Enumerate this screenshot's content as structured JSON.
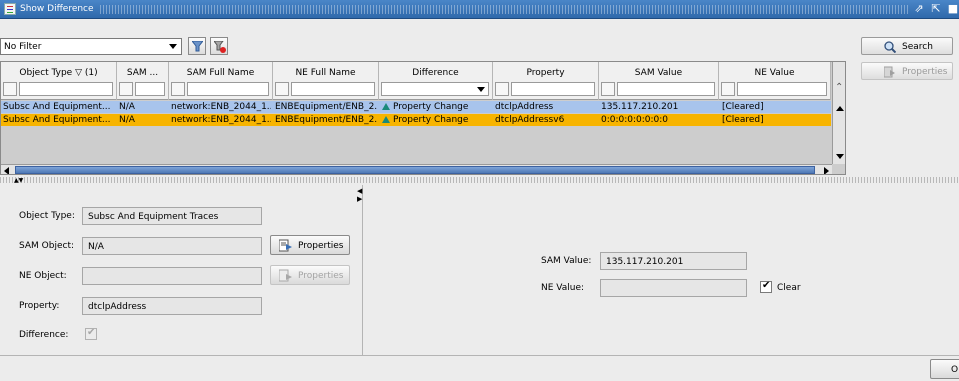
{
  "window": {
    "title": "Show Difference"
  },
  "filter": {
    "selected": "No Filter"
  },
  "buttons": {
    "search": "Search",
    "properties": "Properties",
    "ok": "OK"
  },
  "table": {
    "columns": [
      {
        "label": "Object Type ▽ (1)"
      },
      {
        "label": "SAM ..."
      },
      {
        "label": "SAM Full Name"
      },
      {
        "label": "NE Full Name"
      },
      {
        "label": "Difference"
      },
      {
        "label": "Property"
      },
      {
        "label": "SAM Value"
      },
      {
        "label": "NE Value"
      }
    ],
    "rows": [
      {
        "object_type": "Subsc And Equipment...",
        "sam": "N/A",
        "sam_full_name": "network:ENB_2044_1...",
        "ne_full_name": "ENBEquipment/ENB_2...",
        "difference": "Property Change",
        "property": "dtclpAddress",
        "sam_value": "135.117.210.201",
        "ne_value": "[Cleared]"
      },
      {
        "object_type": "Subsc And Equipment...",
        "sam": "N/A",
        "sam_full_name": "network:ENB_2044_1...",
        "ne_full_name": "ENBEquipment/ENB_2...",
        "difference": "Property Change",
        "property": "dtclpAddressv6",
        "sam_value": "0:0:0:0:0:0:0:0",
        "ne_value": "[Cleared]"
      }
    ]
  },
  "details": {
    "object_type_label": "Object Type:",
    "object_type_value": "Subsc And Equipment Traces",
    "sam_object_label": "SAM Object:",
    "sam_object_value": "N/A",
    "ne_object_label": "NE Object:",
    "ne_object_value": "",
    "property_label": "Property:",
    "property_value": "dtclpAddress",
    "difference_label": "Difference:",
    "sam_value_label": "SAM Value:",
    "sam_value_value": "135.117.210.201",
    "ne_value_label": "NE Value:",
    "ne_value_value": "",
    "clear_label": "Clear"
  },
  "colors": {
    "selected_row": "#a8c4ec",
    "highlight_row": "#f7b400",
    "titlebar": "#3a75b8"
  }
}
